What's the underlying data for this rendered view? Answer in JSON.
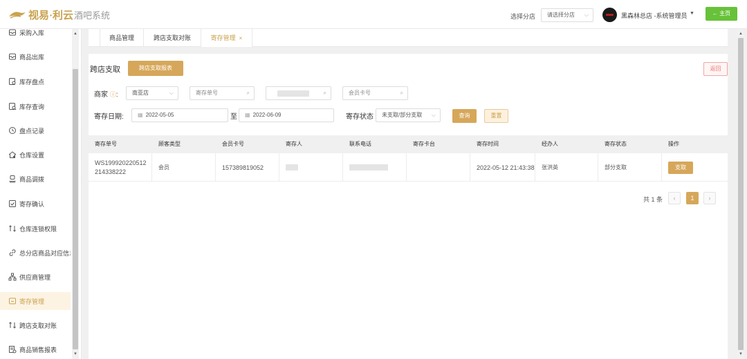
{
  "header": {
    "logo_text": "视易·利云",
    "logo_sub": "酒吧系统",
    "branch_label": "选择分店",
    "branch_placeholder": "请选择分店",
    "user_name": "黑森林总店 -系统管理员",
    "home_label": "← 主页"
  },
  "sidebar": {
    "items": [
      {
        "label": "采购入库",
        "icon": "inbox-icon"
      },
      {
        "label": "商品出库",
        "icon": "outbox-icon"
      },
      {
        "label": "库存盘点",
        "icon": "inventory-check-icon"
      },
      {
        "label": "库存查询",
        "icon": "inventory-search-icon"
      },
      {
        "label": "盘点记录",
        "icon": "history-icon"
      },
      {
        "label": "仓库设置",
        "icon": "warehouse-settings-icon"
      },
      {
        "label": "商品调拨",
        "icon": "transfer-icon"
      },
      {
        "label": "寄存确认",
        "icon": "confirm-icon"
      },
      {
        "label": "仓库连锁权限",
        "icon": "permission-icon"
      },
      {
        "label": "总分店商品对应信息",
        "icon": "link-icon"
      },
      {
        "label": "供应商管理",
        "icon": "supplier-icon"
      },
      {
        "label": "寄存管理",
        "icon": "storage-icon",
        "active": true
      },
      {
        "label": "跨店支取对账",
        "icon": "reconcile-icon"
      },
      {
        "label": "商品销售报表",
        "icon": "report-icon"
      }
    ]
  },
  "tabs": [
    {
      "label": "商品管理"
    },
    {
      "label": "跨店支取对账"
    },
    {
      "label": "寄存管理",
      "active": true,
      "close": "×"
    }
  ],
  "page": {
    "title": "跨店支取",
    "report_button": "跨店支取报表",
    "back_button": "返回"
  },
  "filters": {
    "merchant_label": "商家",
    "merchant_hint_icon": "ⓘ",
    "merchant_colon": ":",
    "merchant_value": "南亚店",
    "storage_no_placeholder": "寄存单号",
    "member_card_placeholder": "会员卡号",
    "date_label": "寄存日期:",
    "date_start": "2022-05-05",
    "date_to": "至",
    "date_end": "2022-06-09",
    "status_label": "寄存状态",
    "status_value": "未支取/部分支取",
    "query_button": "查询",
    "reset_button": "重置"
  },
  "table": {
    "columns": [
      "寄存单号",
      "顾客类型",
      "会员卡号",
      "寄存人",
      "联系电话",
      "寄存卡台",
      "寄存时间",
      "经办人",
      "寄存状态",
      "操作"
    ],
    "rows": [
      {
        "order_no": "WS199920220512214338222",
        "customer_type": "会员",
        "member_card": "157389819052",
        "depositor": "",
        "phone": "",
        "table": "",
        "time": "2022-05-12 21:43:38",
        "handler": "张洪英",
        "status": "部分支取",
        "action": "支取"
      }
    ]
  },
  "pagination": {
    "total": "共 1 条",
    "prev": "‹",
    "current": "1",
    "next": "›"
  },
  "colors": {
    "accent": "#d6a75a",
    "home_button": "#67c23a",
    "back_border": "#f3a5a5"
  }
}
